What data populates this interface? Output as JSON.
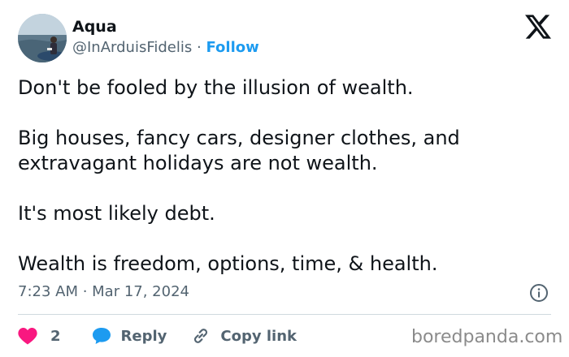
{
  "author": {
    "name": "Aqua",
    "handle": "@InArduisFidelis",
    "separator": "·",
    "follow_label": "Follow"
  },
  "tweet": {
    "paragraphs": [
      "Don't be fooled by the illusion of wealth.",
      "Big houses, fancy cars, designer clothes, and extravagant holidays are not wealth.",
      "It's most likely debt.",
      "Wealth is freedom, options, time, & health."
    ],
    "timestamp": "7:23 AM · Mar 17, 2024"
  },
  "actions": {
    "like_count": "2",
    "reply_label": "Reply",
    "copy_link_label": "Copy link"
  },
  "watermark": "boredpanda.com",
  "icons": {
    "brand": "x-logo-icon",
    "info": "info-icon",
    "like": "heart-icon",
    "reply": "speech-bubble-icon",
    "copy": "link-icon"
  },
  "colors": {
    "follow": "#1d9bf0",
    "like": "#f91880",
    "reply": "#1d9bf0",
    "muted": "#536471"
  }
}
